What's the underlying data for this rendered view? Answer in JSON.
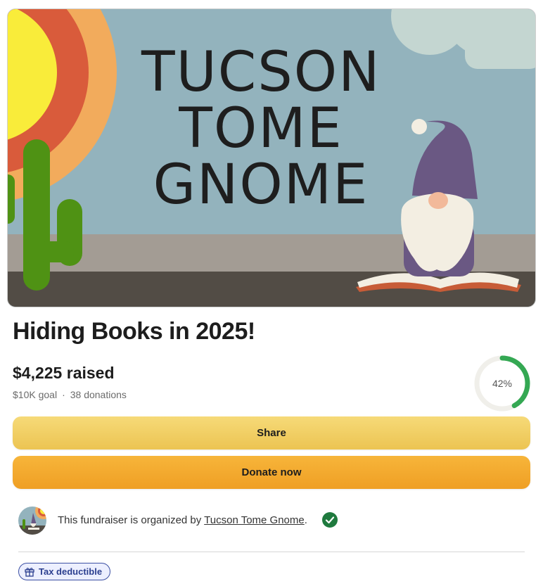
{
  "hero": {
    "line1": "TUCSON",
    "line2": "TOME",
    "line3": "GNOME"
  },
  "campaign": {
    "title": "Hiding Books in 2025!",
    "raised": "$4,225 raised",
    "goal": "$10K goal",
    "separator": "·",
    "donations": "38 donations",
    "progress_label": "42%",
    "progress_fraction": 0.42
  },
  "actions": {
    "share_label": "Share",
    "donate_label": "Donate now"
  },
  "organizer": {
    "prefix": "This fundraiser is organized by ",
    "name": "Tucson Tome Gnome",
    "suffix": "."
  },
  "badge": {
    "label": "Tax deductible",
    "icon": "gift-icon"
  },
  "colors": {
    "progress": "#34a853",
    "share_button": "#f0cd62",
    "donate_button": "#f2a92e",
    "verified": "#1f7a3e",
    "badge_border": "#3b4fa3"
  }
}
